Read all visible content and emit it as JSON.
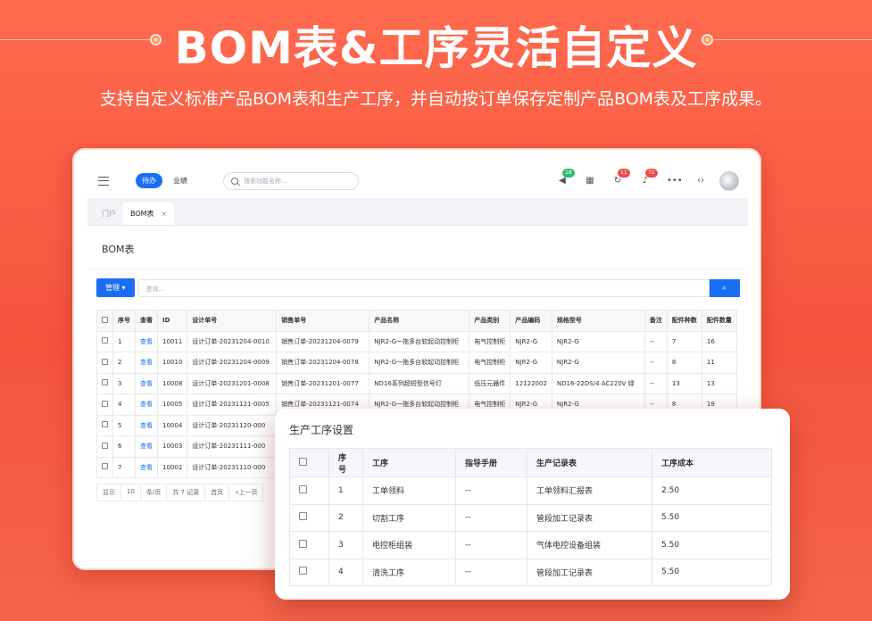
{
  "hero": {
    "title": "BOM表&工序灵活自定义",
    "subtitle": "支持自定义标准产品BOM表和生产工序，并自动按订单保存定制产品BOM表及工序成果。"
  },
  "topbar": {
    "tab_active": "待办",
    "tab_other": "业绩",
    "search_placeholder": "搜索功能名称...",
    "badges": {
      "message": "18",
      "refresh": "11",
      "bell": "72"
    }
  },
  "tabs": {
    "home": "门户",
    "current": "BOM表",
    "close": "×"
  },
  "page": {
    "title": "BOM表",
    "manage_label": "管理 ▾",
    "query_placeholder": "查询..."
  },
  "table": {
    "headers": [
      "序号",
      "查看",
      "ID",
      "设计单号",
      "销售单号",
      "产品名称",
      "产品类别",
      "产品编码",
      "规格型号",
      "备注",
      "配件种数",
      "配件数量"
    ],
    "rows": [
      [
        "1",
        "查看",
        "10011",
        "设计订单-20231204-0010",
        "销售订单-20231204-0079",
        "NJR2-G一拖多台软起动控制柜",
        "电气控制柜",
        "NJR2-G",
        "NJR2-G",
        "--",
        "7",
        "16"
      ],
      [
        "2",
        "查看",
        "10010",
        "设计订单-20231204-0009",
        "销售订单-20231204-0078",
        "NJR2-G一拖多台软起动控制柜",
        "电气控制柜",
        "NJR2-G",
        "NJR2-G",
        "--",
        "8",
        "11"
      ],
      [
        "3",
        "查看",
        "10008",
        "设计订单-20231201-0008",
        "销售订单-20231201-0077",
        "ND16系列超短型信号灯",
        "低压元器件",
        "12122002",
        "ND16-22DS/4 AC220V 绿",
        "--",
        "13",
        "13"
      ],
      [
        "4",
        "查看",
        "10005",
        "设计订单-20231121-0005",
        "销售订单-20231121-0074",
        "NJR2-G一拖多台软起动控制柜",
        "电气控制柜",
        "NJR2-G",
        "NJR2-G",
        "--",
        "8",
        "19"
      ],
      [
        "5",
        "查看",
        "10004",
        "设计订单-20231120-000",
        "",
        "",
        "",
        "",
        "",
        "",
        "",
        ""
      ],
      [
        "6",
        "查看",
        "10003",
        "设计订单-20231111-000",
        "",
        "",
        "",
        "",
        "",
        "",
        "",
        ""
      ],
      [
        "7",
        "查看",
        "10002",
        "设计订单-20231110-000",
        "",
        "",
        "",
        "",
        "",
        "",
        "",
        ""
      ]
    ]
  },
  "pager": {
    "show": "显示",
    "size": "10",
    "per": "条/页",
    "total": "共 7 记录",
    "first": "首页",
    "prev": "«上一页"
  },
  "process": {
    "title": "生产工序设置",
    "headers": [
      "序号",
      "工序",
      "指导手册",
      "生产记录表",
      "工序成本"
    ],
    "rows": [
      [
        "1",
        "工单领料",
        "--",
        "工单领料汇报表",
        "2.50"
      ],
      [
        "2",
        "切割工序",
        "--",
        "管段加工记录表",
        "5.50"
      ],
      [
        "3",
        "电控柜组装",
        "--",
        "气体电控设备组装",
        "5.50"
      ],
      [
        "4",
        "清洗工序",
        "--",
        "管段加工记录表",
        "5.50"
      ]
    ]
  }
}
